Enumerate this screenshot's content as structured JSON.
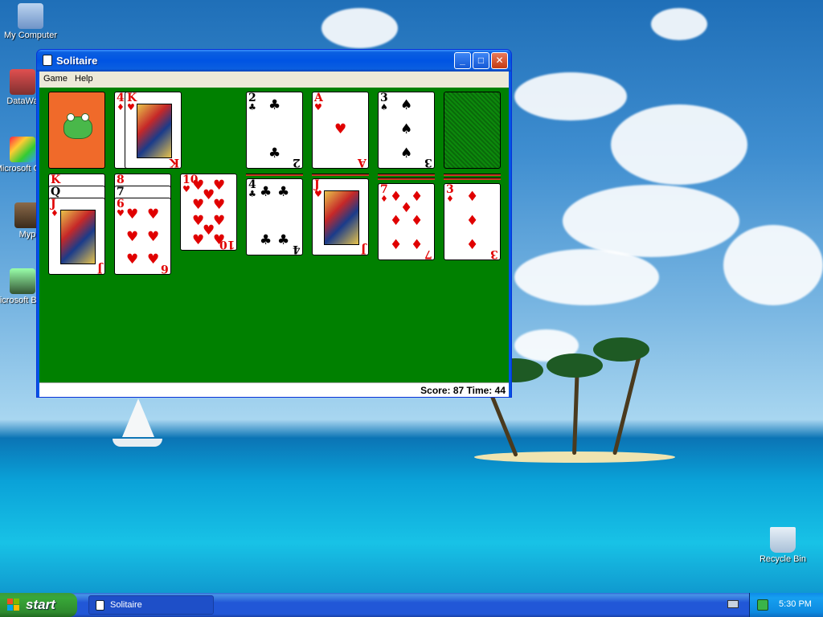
{
  "desktop": {
    "icons": [
      {
        "label": "My Computer",
        "icon": "my-computer-icon"
      },
      {
        "label": "DataWa",
        "icon": "datawa-shortcut-icon"
      },
      {
        "label": "Microsoft C++",
        "icon": "visual-cpp-shortcut-icon"
      },
      {
        "label": "Myp",
        "icon": "myp-shortcut-icon"
      },
      {
        "label": "Microsoft Basic",
        "icon": "visual-basic-shortcut-icon"
      },
      {
        "label": "Recycle Bin",
        "icon": "recycle-bin-icon"
      }
    ]
  },
  "window": {
    "title": "Solitaire",
    "controls": {
      "minimize": "_",
      "maximize": "□",
      "close": "✕"
    },
    "menu": [
      "Game",
      "Help"
    ],
    "status": "Score: 87 Time: 44"
  },
  "game": {
    "stock": {
      "card_back": "frog-back"
    },
    "waste": {
      "top_card": {
        "rank": "K",
        "suit": "♥",
        "color": "red"
      },
      "under_card": {
        "rank": "4",
        "suit": "♦",
        "color": "red"
      }
    },
    "foundations": [
      {
        "rank": "2",
        "suit": "♣",
        "color": "black"
      },
      {
        "rank": "A",
        "suit": "♥",
        "color": "red"
      },
      {
        "rank": "3",
        "suit": "♠",
        "color": "black"
      },
      {
        "empty": true
      }
    ],
    "tableau": [
      {
        "stack": [
          {
            "rank": "K",
            "suit": "♠",
            "color": "red"
          },
          {
            "rank": "Q",
            "suit": "♠",
            "color": "black"
          }
        ],
        "top": {
          "rank": "J",
          "suit": "♦",
          "color": "red"
        }
      },
      {
        "stack": [
          {
            "rank": "8",
            "suit": "♠",
            "color": "red"
          },
          {
            "rank": "7",
            "suit": "♠",
            "color": "black"
          }
        ],
        "top": {
          "rank": "6",
          "suit": "♥",
          "color": "red"
        }
      },
      {
        "stack": [],
        "top": {
          "rank": "10",
          "suit": "♥",
          "color": "red"
        }
      },
      {
        "facedown": 1,
        "top": {
          "rank": "4",
          "suit": "♣",
          "color": "black"
        }
      },
      {
        "facedown": 1,
        "top": {
          "rank": "J",
          "suit": "♥",
          "color": "red"
        }
      },
      {
        "facedown": 2,
        "top": {
          "rank": "7",
          "suit": "♦",
          "color": "red"
        }
      },
      {
        "facedown": 2,
        "top": {
          "rank": "3",
          "suit": "♦",
          "color": "red"
        }
      }
    ]
  },
  "taskbar": {
    "start_label": "start",
    "task_label": "Solitaire",
    "clock": "5:30 PM"
  }
}
